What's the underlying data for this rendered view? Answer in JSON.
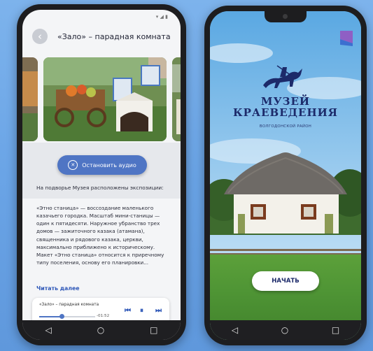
{
  "left_screen": {
    "status_icons": "▾ ◢ ▮",
    "back_icon": "‹",
    "title": "«Зало» – парадная комната",
    "audio_button": {
      "icon": "✕",
      "label": "Остановить аудио"
    },
    "intro": "На подворье Музея расположены экспозиции:",
    "body": "«Этно станица» — воссоздание маленького казачьего городка. Масштаб мини-станицы — один к пятидесяти. Наружное убранство трех домов — зажиточного казака (атамана), священника и рядового казака, церкви, максимально приближено к историческому. Макет «Этно станица» относится к приречному типу поселения, основу его планировки...",
    "read_more": "Читать далее",
    "player": {
      "track_title": "«Зало» – парадная комната",
      "time": "-01:52",
      "progress": 0.4,
      "prev_icon": "⏮",
      "pause_icon": "⏸",
      "next_icon": "⏭"
    },
    "nav": {
      "back": "◁",
      "home": "○",
      "recents": "□"
    }
  },
  "right_screen": {
    "museum_title_line1": "МУЗЕЙ",
    "museum_title_line2": "КРАЕВЕДЕНИЯ",
    "subtitle": "ВОЛГОДОНСКОЙ РАЙОН",
    "start_button": "НАЧАТЬ",
    "nav": {
      "back": "◁",
      "home": "○",
      "recents": "□"
    }
  },
  "colors": {
    "accent": "#4f75c4",
    "title_blue": "#1c2a6a",
    "background": "#6aa4e6"
  }
}
